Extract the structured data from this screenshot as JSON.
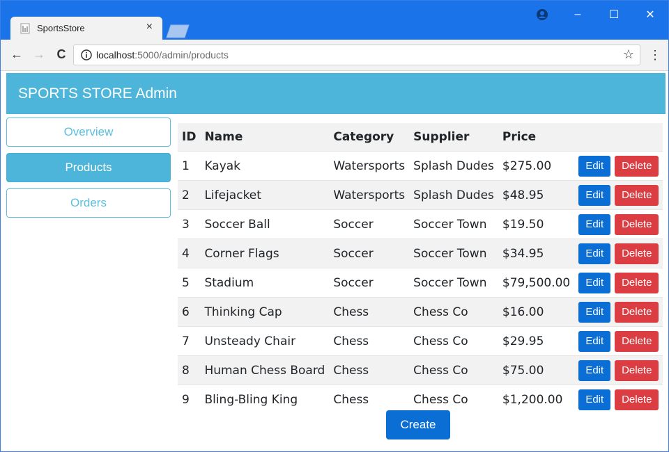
{
  "browser": {
    "tab_title": "SportsStore",
    "tab_close": "×",
    "url_host": "localhost",
    "url_rest": ":5000/admin/products",
    "window_controls": {
      "minimize": "–",
      "maximize": "☐",
      "close": "✕"
    },
    "nav": {
      "back": "←",
      "forward": "→",
      "reload": "C"
    },
    "star": "☆",
    "menu": "⋮"
  },
  "app": {
    "title": "SPORTS STORE Admin"
  },
  "sidebar": {
    "items": [
      {
        "label": "Overview",
        "active": false
      },
      {
        "label": "Products",
        "active": true
      },
      {
        "label": "Orders",
        "active": false
      }
    ]
  },
  "table": {
    "headers": [
      "ID",
      "Name",
      "Category",
      "Supplier",
      "Price"
    ],
    "rows": [
      {
        "id": "1",
        "name": "Kayak",
        "category": "Watersports",
        "supplier": "Splash Dudes",
        "price": "$275.00"
      },
      {
        "id": "2",
        "name": "Lifejacket",
        "category": "Watersports",
        "supplier": "Splash Dudes",
        "price": "$48.95"
      },
      {
        "id": "3",
        "name": "Soccer Ball",
        "category": "Soccer",
        "supplier": "Soccer Town",
        "price": "$19.50"
      },
      {
        "id": "4",
        "name": "Corner Flags",
        "category": "Soccer",
        "supplier": "Soccer Town",
        "price": "$34.95"
      },
      {
        "id": "5",
        "name": "Stadium",
        "category": "Soccer",
        "supplier": "Soccer Town",
        "price": "$79,500.00"
      },
      {
        "id": "6",
        "name": "Thinking Cap",
        "category": "Chess",
        "supplier": "Chess Co",
        "price": "$16.00"
      },
      {
        "id": "7",
        "name": "Unsteady Chair",
        "category": "Chess",
        "supplier": "Chess Co",
        "price": "$29.95"
      },
      {
        "id": "8",
        "name": "Human Chess Board",
        "category": "Chess",
        "supplier": "Chess Co",
        "price": "$75.00"
      },
      {
        "id": "9",
        "name": "Bling-Bling King",
        "category": "Chess",
        "supplier": "Chess Co",
        "price": "$1,200.00"
      }
    ],
    "edit_label": "Edit",
    "delete_label": "Delete"
  },
  "create_label": "Create",
  "colors": {
    "browser_accent": "#1a73e8",
    "header": "#4cb5d9",
    "primary": "#0b6ed4",
    "danger": "#dc3d42"
  }
}
